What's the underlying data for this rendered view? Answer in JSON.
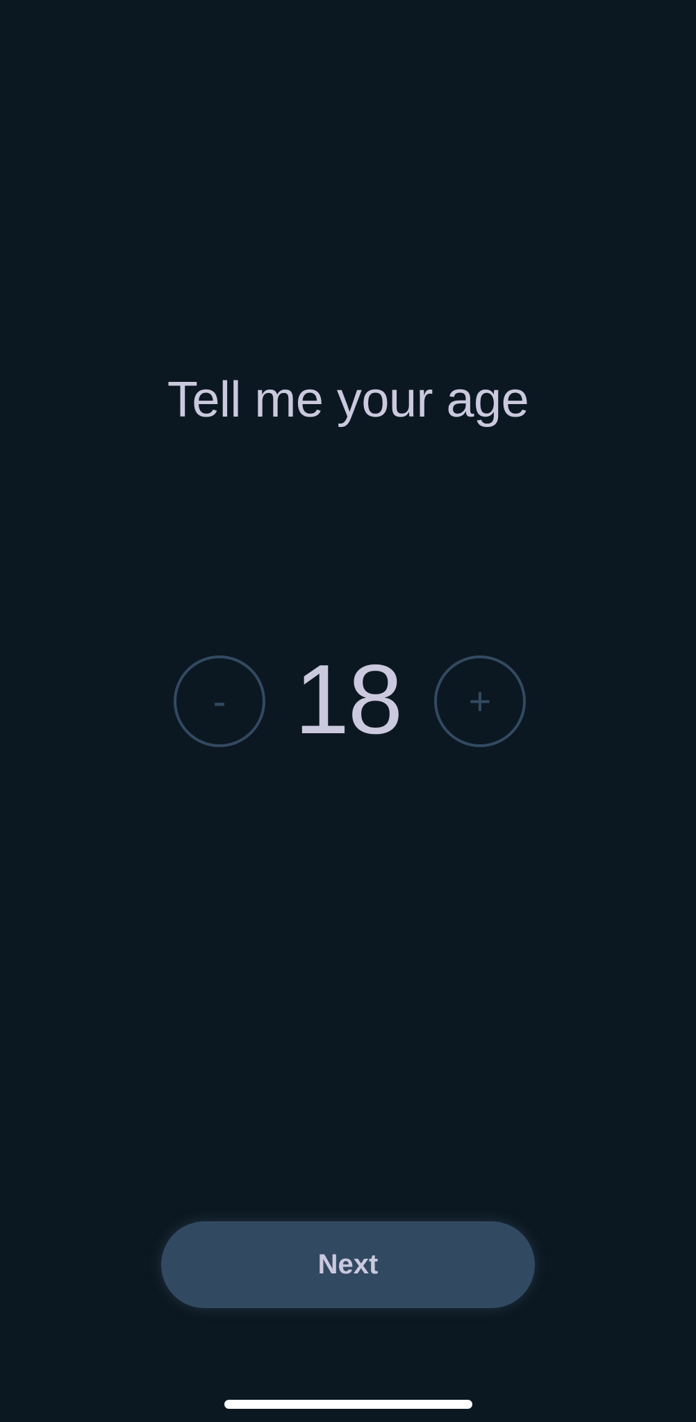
{
  "screen": {
    "title": "Tell me your age"
  },
  "stepper": {
    "decrement_label": "-",
    "value": "18",
    "increment_label": "+"
  },
  "footer": {
    "next_label": "Next"
  },
  "colors": {
    "background": "#0c1821",
    "text": "#cbc9de",
    "accent": "#324a61",
    "home_indicator": "#ffffff"
  }
}
